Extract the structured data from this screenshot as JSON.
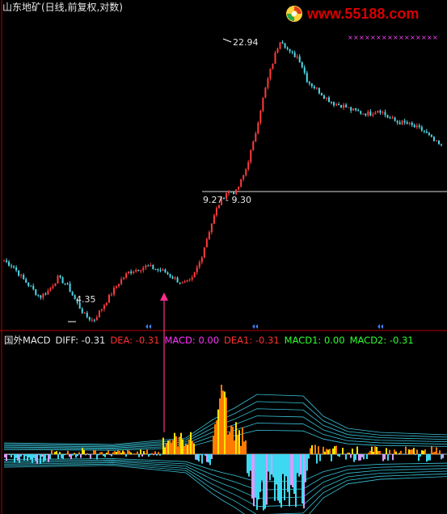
{
  "window": {
    "title": "山东地矿(日线,前复权,对数)",
    "logo_text": "www.55188.com"
  },
  "colors": {
    "background": "#000000",
    "candle_up": "#ff3b3b",
    "candle_down": "#4fd8e8",
    "divider": "#b00000",
    "macd_orange": "#ff7a00",
    "macd_yellow": "#ffe400",
    "macd_cyan": "#3ed8f0",
    "macd_violet": "#d69cff",
    "arrow": "#ff2d8c"
  },
  "annotations": {
    "high": "22.94",
    "low": "4.35",
    "gap_range": "9.27 - 9.30"
  },
  "macd_panel": {
    "indicator": "国外MACD",
    "diff": "DIFF: -0.31",
    "dea": "DEA: -0.31",
    "macd": "MACD: 0.00",
    "dea1": "DEA1: -0.31",
    "macd1": "MACD1: 0.00",
    "macd2": "MACD2: -0.31"
  },
  "chart_data": [
    {
      "type": "candlestick",
      "title": "山东地矿(日线,前复权,对数)",
      "scale": "log",
      "y_annotations": [
        22.94,
        9.27,
        9.3,
        4.35
      ],
      "series": [
        {
          "values": [
            6.2,
            6.0,
            5.6,
            5.3,
            5.0,
            5.2,
            5.6,
            5.4,
            4.9,
            4.5,
            4.35,
            4.7,
            5.1,
            5.5,
            5.8,
            5.9,
            6.0,
            5.9,
            5.8,
            5.6,
            5.4,
            5.5,
            6.2,
            7.4,
            8.6,
            9.3,
            9.27,
            10.4,
            12.5,
            16.0,
            19.5,
            22.94,
            21.0,
            20.5,
            17.8,
            17.0,
            16.2,
            15.6,
            15.4,
            15.0,
            14.8,
            14.7,
            15.1,
            14.4,
            14.0,
            13.9,
            13.6,
            13.3,
            12.6,
            12.1
          ]
        }
      ]
    },
    {
      "type": "bar",
      "title": "国外MACD",
      "series": [
        {
          "name": "DIFF",
          "last": -0.31
        },
        {
          "name": "DEA",
          "last": -0.31
        },
        {
          "name": "MACD",
          "last": 0.0
        },
        {
          "name": "DEA1",
          "last": -0.31
        },
        {
          "name": "MACD1",
          "last": 0.0
        },
        {
          "name": "MACD2",
          "last": -0.31
        }
      ]
    }
  ]
}
